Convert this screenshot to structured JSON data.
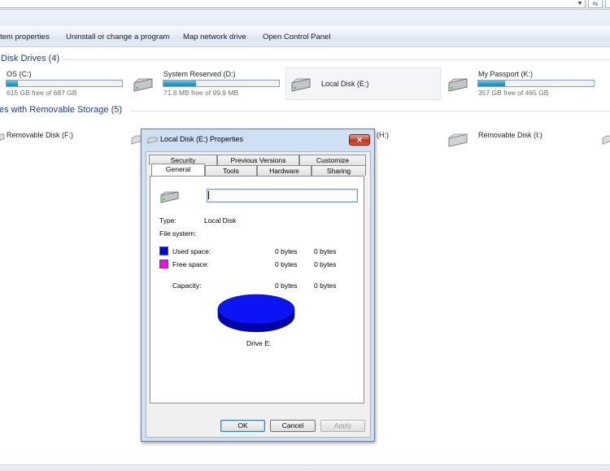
{
  "command_bar": {
    "system_properties": "tem properties",
    "uninstall": "Uninstall or change a program",
    "map_drive": "Map network drive",
    "control_panel": "Open Control Panel"
  },
  "groups": {
    "hard_disks": "Disk Drives (4)",
    "removable": "es with Removable Storage (5)"
  },
  "drives": [
    {
      "name": "OS (C:)",
      "free": "615 GB free of 687 GB",
      "used_fraction": 0.1
    },
    {
      "name": "System Reserved (D:)",
      "free": "71.8 MB free of 99.9 MB",
      "used_fraction": 0.28
    },
    {
      "name": "Local Disk (E:)"
    },
    {
      "name": "My Passport (K:)",
      "free": "357 GB free of 465 GB",
      "used_fraction": 0.23
    }
  ],
  "removable_drives": [
    {
      "name": "Removable Disk (F:)"
    },
    {
      "name": "(H:)"
    },
    {
      "name": "Removable Disk (I:)"
    }
  ],
  "dialog": {
    "title": "Local Disk (E:) Properties",
    "close": "✕",
    "tabs_row1": [
      "Security",
      "Previous Versions",
      "Customize"
    ],
    "tabs_row2": [
      "General",
      "Tools",
      "Hardware",
      "Sharing"
    ],
    "label_value": "",
    "type_label": "Type:",
    "type_value": "Local Disk",
    "fs_label": "File system:",
    "fs_value": "",
    "used_label": "Used space:",
    "used_bytes": "0 bytes",
    "used_size": "0 bytes",
    "free_label": "Free space:",
    "free_bytes": "0 bytes",
    "free_size": "0 bytes",
    "capacity_label": "Capacity:",
    "capacity_bytes": "0 bytes",
    "capacity_size": "0 bytes",
    "drive_caption": "Drive E:",
    "ok": "OK",
    "cancel": "Cancel",
    "apply": "Apply"
  },
  "colors": {
    "used": "#0000ff",
    "free": "#ff00ff",
    "pie_top": "#0a14f5",
    "pie_side": "#0000a8"
  },
  "icons": {
    "hard-disk": "hard-disk-icon",
    "removable": "removable-disk-icon",
    "refresh": "refresh-icon"
  }
}
